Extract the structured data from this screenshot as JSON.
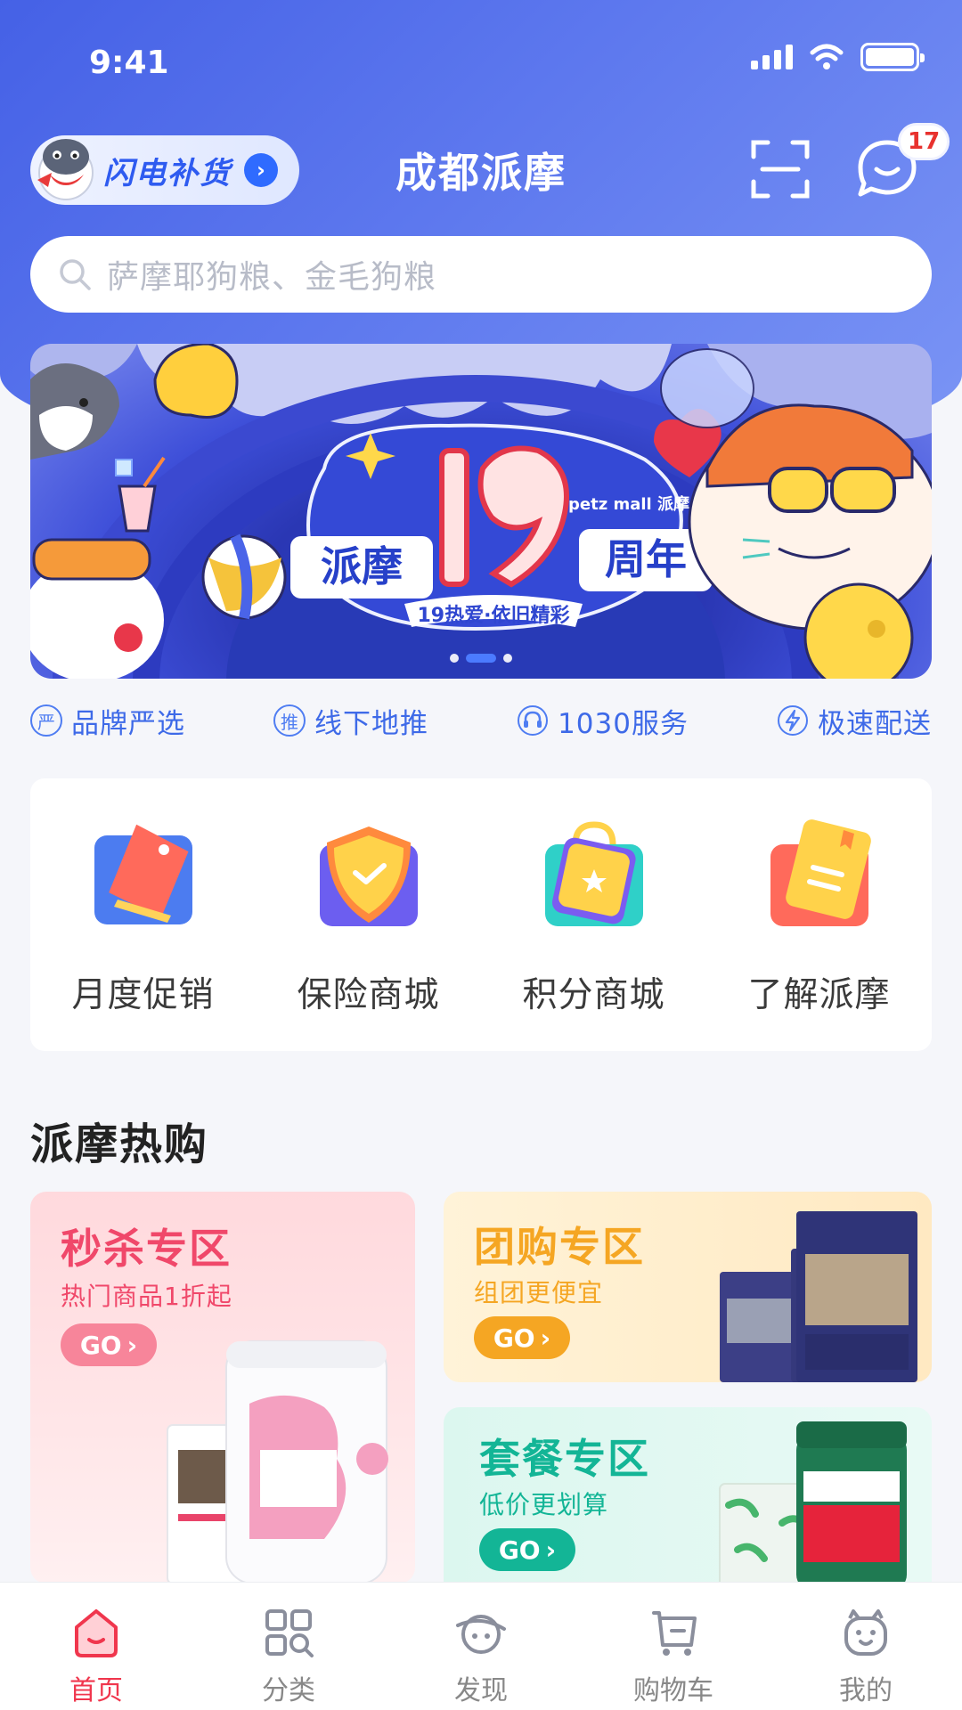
{
  "status_bar": {
    "time": "9:41"
  },
  "header": {
    "flash_label": "闪电补货",
    "city_title": "成都派摩",
    "message_count": "17"
  },
  "search": {
    "placeholder": "萨摩耶狗粮、金毛狗粮"
  },
  "banner": {
    "brand_text": "petz mall 派摩",
    "left_text": "派摩",
    "number": "19",
    "right_text": "周年",
    "slogan": "19热爱·依旧精彩",
    "active_slide": 2,
    "slide_count": 3
  },
  "features": [
    {
      "icon": "严",
      "label": "品牌严选",
      "icon_name": "brand-select-icon"
    },
    {
      "icon": "推",
      "label": "线下地推",
      "icon_name": "offline-promo-icon"
    },
    {
      "icon": "◌",
      "label": "1030服务",
      "icon_name": "headset-icon"
    },
    {
      "icon": "⚡",
      "label": "极速配送",
      "icon_name": "lightning-icon"
    }
  ],
  "quick_links": [
    {
      "label": "月度促销",
      "icon_name": "tag-icon"
    },
    {
      "label": "保险商城",
      "icon_name": "shield-icon"
    },
    {
      "label": "积分商城",
      "icon_name": "shopping-bag-icon"
    },
    {
      "label": "了解派摩",
      "icon_name": "book-icon"
    }
  ],
  "section": {
    "title": "派摩热购"
  },
  "promos": {
    "flash_sale": {
      "title": "秒杀专区",
      "subtitle": "热门商品1折起",
      "go": "GO",
      "color": "#f0486a"
    },
    "group_buy": {
      "title": "团购专区",
      "subtitle": "组团更便宜",
      "go": "GO",
      "color": "#f5a623"
    },
    "bundle": {
      "title": "套餐专区",
      "subtitle": "低价更划算",
      "go": "GO",
      "color": "#13b596"
    }
  },
  "tab_bar": [
    {
      "label": "首页",
      "active": true
    },
    {
      "label": "分类",
      "active": false
    },
    {
      "label": "发现",
      "active": false
    },
    {
      "label": "购物车",
      "active": false
    },
    {
      "label": "我的",
      "active": false
    }
  ],
  "colors": {
    "brand_blue": "#4561e6",
    "accent_red": "#f0364d"
  }
}
